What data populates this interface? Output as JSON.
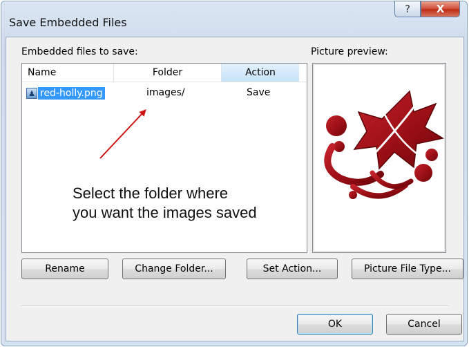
{
  "window": {
    "title": "Save Embedded Files",
    "help_glyph": "?",
    "close_glyph": "X"
  },
  "embedded_label": "Embedded files to save:",
  "preview_label": "Picture preview:",
  "list": {
    "columns": [
      "Name",
      "Folder",
      "Action"
    ],
    "rows": [
      {
        "name": "red-holly.png",
        "folder": "images/",
        "action": "Save",
        "selected": true
      }
    ]
  },
  "annotation": {
    "line1": "Select the folder where",
    "line2": "you want the images saved",
    "color": "#cc1111"
  },
  "preview_image": {
    "description_icon": "red-holly-icon",
    "fill": "#9b0f16"
  },
  "buttons": {
    "rename": "Rename",
    "change_folder": "Change Folder...",
    "set_action": "Set Action...",
    "picture_file_type": "Picture File Type...",
    "ok": "OK",
    "cancel": "Cancel"
  }
}
